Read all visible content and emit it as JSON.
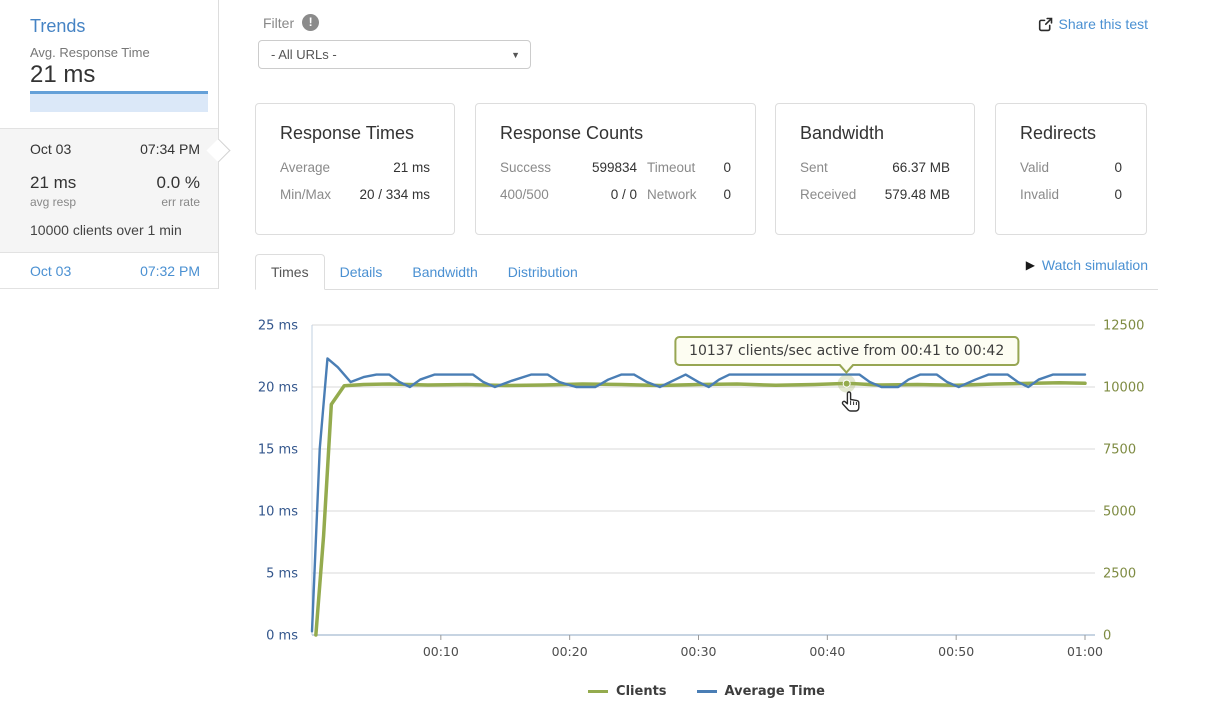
{
  "sidebar": {
    "title": "Trends",
    "metric_label": "Avg. Response Time",
    "metric_value": "21 ms",
    "selected_test": {
      "date": "Oct 03",
      "time": "07:34 PM",
      "avg_value": "21 ms",
      "avg_label": "avg resp",
      "err_value": "0.0 %",
      "err_label": "err rate",
      "summary": "10000 clients over 1 min"
    },
    "previous_test": {
      "date": "Oct 03",
      "time": "07:32 PM"
    }
  },
  "header": {
    "filter_label": "Filter",
    "filter_info_icon": "exclamation-circle",
    "filter_selected_option": "- All URLs -",
    "share_label": "Share this test"
  },
  "cards": {
    "response_times": {
      "title": "Response Times",
      "rows": [
        {
          "label": "Average",
          "value": "21 ms"
        },
        {
          "label": "Min/Max",
          "value": "20 / 334 ms"
        }
      ]
    },
    "response_counts": {
      "title": "Response Counts",
      "cells": [
        {
          "label": "Success",
          "value": "599834"
        },
        {
          "label": "Timeout",
          "value": "0"
        },
        {
          "label": "400/500",
          "value": "0 / 0"
        },
        {
          "label": "Network",
          "value": "0"
        }
      ]
    },
    "bandwidth": {
      "title": "Bandwidth",
      "rows": [
        {
          "label": "Sent",
          "value": "66.37 MB"
        },
        {
          "label": "Received",
          "value": "579.48 MB"
        }
      ]
    },
    "redirects": {
      "title": "Redirects",
      "rows": [
        {
          "label": "Valid",
          "value": "0"
        },
        {
          "label": "Invalid",
          "value": "0"
        }
      ]
    }
  },
  "tabs": {
    "items": [
      "Times",
      "Details",
      "Bandwidth",
      "Distribution"
    ],
    "active": "Times"
  },
  "watch_label": "Watch simulation",
  "chart_data": {
    "type": "line",
    "x_max": 60,
    "x_ticks": [
      {
        "s": 10,
        "label": "00:10"
      },
      {
        "s": 20,
        "label": "00:20"
      },
      {
        "s": 30,
        "label": "00:30"
      },
      {
        "s": 40,
        "label": "00:40"
      },
      {
        "s": 50,
        "label": "00:50"
      },
      {
        "s": 60,
        "label": "01:00"
      }
    ],
    "left_axis": {
      "max": 25,
      "values": [
        0,
        5,
        10,
        15,
        20,
        25
      ],
      "labels": [
        "0 ms",
        "5 ms",
        "10 ms",
        "15 ms",
        "20 ms",
        "25 ms"
      ]
    },
    "right_axis": {
      "max": 12500,
      "values": [
        0,
        2500,
        5000,
        7500,
        10000,
        12500
      ],
      "labels": [
        "0",
        "2500",
        "5000",
        "7500",
        "10000",
        "12500"
      ]
    },
    "grid": true,
    "legend_position": "bottom",
    "series": [
      {
        "name": "Clients",
        "axis": "right",
        "color": "#94ab4e",
        "width": 3.5,
        "x": [
          0.3,
          0.9,
          1.5,
          2.5,
          4,
          6,
          9,
          12,
          15,
          18,
          21,
          24,
          27,
          30,
          33,
          36,
          39,
          41,
          42,
          44,
          47,
          50,
          53,
          56,
          58,
          60
        ],
        "y": [
          0,
          4000,
          9300,
          10050,
          10100,
          10120,
          10080,
          10100,
          10060,
          10080,
          10120,
          10100,
          10060,
          10100,
          10120,
          10070,
          10100,
          10137,
          10137,
          10080,
          10100,
          10070,
          10120,
          10150,
          10170,
          10150
        ]
      },
      {
        "name": "Average Time",
        "axis": "left",
        "color": "#4a7eb5",
        "width": 2.4,
        "x": [
          0,
          0.6,
          1.2,
          2,
          3,
          4,
          5,
          6,
          6.8,
          7.6,
          8.4,
          9.5,
          11,
          12.5,
          13.3,
          14.2,
          15.5,
          17,
          18.3,
          19.2,
          20.5,
          22,
          23,
          24,
          25,
          26,
          27,
          28.2,
          29,
          30,
          30.8,
          31.6,
          32.4,
          33.5,
          35,
          36.5,
          38,
          39.5,
          41,
          42.5,
          43.3,
          44.2,
          45.5,
          46.3,
          47.2,
          48.5,
          49.3,
          50.2,
          51.5,
          52.5,
          54,
          54.8,
          55.6,
          56.4,
          57.5,
          59,
          60
        ],
        "y": [
          0.3,
          15,
          22.3,
          21.6,
          20.4,
          20.8,
          21,
          21,
          20.4,
          20,
          20.6,
          21,
          21,
          21,
          20.4,
          20,
          20.5,
          21,
          21,
          20.4,
          20,
          20,
          20.6,
          21,
          21,
          20.4,
          20,
          20.6,
          21,
          20.4,
          20,
          20.6,
          21,
          21,
          21,
          21,
          21,
          21,
          21,
          21,
          20.4,
          20,
          20,
          20.6,
          21,
          21,
          20.4,
          20,
          20.6,
          21,
          21,
          20.4,
          20,
          20.6,
          21,
          21,
          21
        ]
      }
    ],
    "tooltip": {
      "text": "10137 clients/sec active from 00:41 to 00:42",
      "x_seconds": 41.5,
      "value": 10137,
      "axis": "right"
    }
  }
}
